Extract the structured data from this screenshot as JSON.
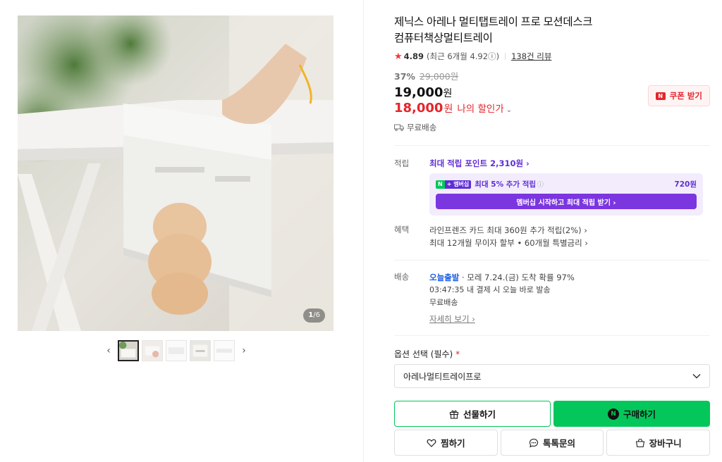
{
  "gallery": {
    "counter_current": "1",
    "counter_total": "/6",
    "prev_arrow": "‹",
    "next_arrow": "›"
  },
  "product": {
    "title_line1": "제닉스 아레나 멀티탭트레이 프로 모션데스크",
    "title_line2": "컴퓨터책상멀티트레이",
    "rating": "4.89",
    "recent_rating": "(최근 6개월 4.92ⓘ)",
    "review_count": "138건 리뷰",
    "discount_rate": "37%",
    "original_price": "29,000원",
    "sale_price": "19,000",
    "my_price": "18,000",
    "won": "원",
    "my_discount_label": "나의 할인가",
    "coupon_label": "쿠폰 받기",
    "shipping": "무료배송"
  },
  "points": {
    "label": "적립",
    "max_points": "최대 적립 포인트 2,310원 ›",
    "member_badge_n": "N",
    "member_badge_plus": "+ 멤버십",
    "member_text": "최대 5% 추가 적립",
    "member_info": "ⓘ",
    "member_amount": "720원",
    "member_button": "멤버십 시작하고 최대 적립 받기 ›"
  },
  "benefits": {
    "label": "혜택",
    "line1": "라인프렌즈 카드 최대 360원 추가 적립(2%) ›",
    "line2": "최대 12개월 무이자 할부 • 60개월 특별금리 ›"
  },
  "delivery": {
    "label": "배송",
    "today_tag": "오늘출발",
    "arrival": " · 모레 7.24.(금) 도착 확률 97%",
    "deadline": "03:47:35  내 결제 시 오늘 바로 발송",
    "fee": "무료배송",
    "more": "자세히 보기 ›"
  },
  "options": {
    "label": "옵션 선택 (필수) ",
    "required_mark": "*",
    "selected": "아레나멀티트레이프로"
  },
  "actions": {
    "gift": "선물하기",
    "buy": "구매하기",
    "buy_badge": "N",
    "wish": "찜하기",
    "talk": "톡톡문의",
    "cart": "장바구니"
  },
  "colors": {
    "accent_green": "#03c75a",
    "sale_red": "#e4262b",
    "member_purple": "#5f2ed6"
  }
}
